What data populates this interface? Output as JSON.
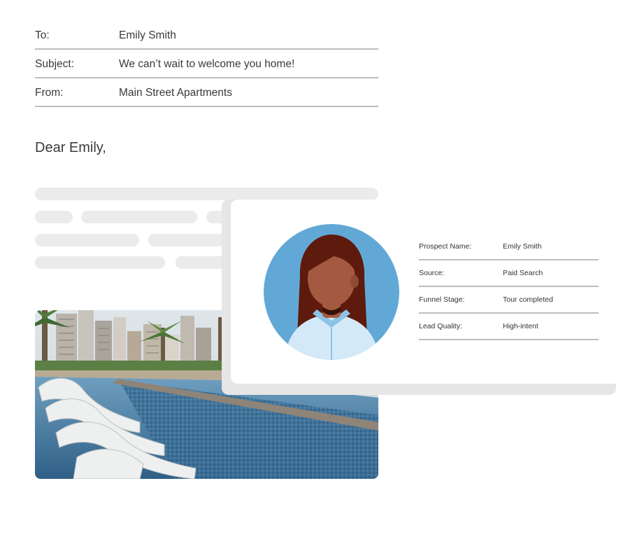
{
  "email": {
    "to_label": "To:",
    "to_value": "Emily Smith",
    "subject_label": "Subject:",
    "subject_value": "We can’t wait to welcome you home!",
    "from_label": "From:",
    "from_value": "Main Street Apartments",
    "greeting": "Dear Emily,"
  },
  "prospect": {
    "fields": [
      {
        "label": "Prospect Name:",
        "value": "Emily Smith"
      },
      {
        "label": "Source:",
        "value": "Paid Search"
      },
      {
        "label": "Funnel Stage:",
        "value": "Tour completed"
      },
      {
        "label": "Lead Quality:",
        "value": "High-intent"
      }
    ]
  },
  "colors": {
    "avatar_bg": "#62a8d6",
    "hair": "#5e1a0c",
    "skin": "#a45a40",
    "shirt": "#d4e9f7",
    "placeholder_bar": "#ebebeb",
    "divider": "#bdbdbd"
  }
}
